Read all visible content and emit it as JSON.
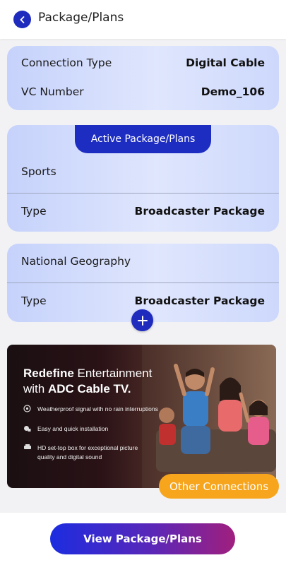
{
  "header": {
    "title": "Package/Plans"
  },
  "connection_card": {
    "rows": [
      {
        "label": "Connection Type",
        "value": "Digital Cable"
      },
      {
        "label": "VC Number",
        "value": "Demo_106"
      }
    ]
  },
  "active_card": {
    "tab_label": "Active Package/Plans",
    "name": "Sports",
    "type_label": "Type",
    "type_value": "Broadcaster Package"
  },
  "second_card": {
    "name": "National Geography",
    "type_label": "Type",
    "type_value": "Broadcaster Package"
  },
  "banner": {
    "headline_1_bold": "Redefine",
    "headline_1_rest": " Entertainment",
    "headline_2_pre": "with ",
    "headline_2_bold": "ADC Cable TV.",
    "features": [
      "Weatherproof signal with no rain interruptions",
      "Easy and quick installation",
      "HD set-top box for exceptional picture",
      "quality and digital sound"
    ]
  },
  "other_connections_label": "Other Connections",
  "view_button_label": "View Package/Plans",
  "colors": {
    "primary_blue": "#1f2bbd",
    "accent_orange": "#f6a51d",
    "card_gradient": "#c6d2fb"
  },
  "icons": [
    "chevron-left-icon",
    "plus-icon",
    "weather-icon",
    "installation-icon",
    "settop-box-icon"
  ]
}
